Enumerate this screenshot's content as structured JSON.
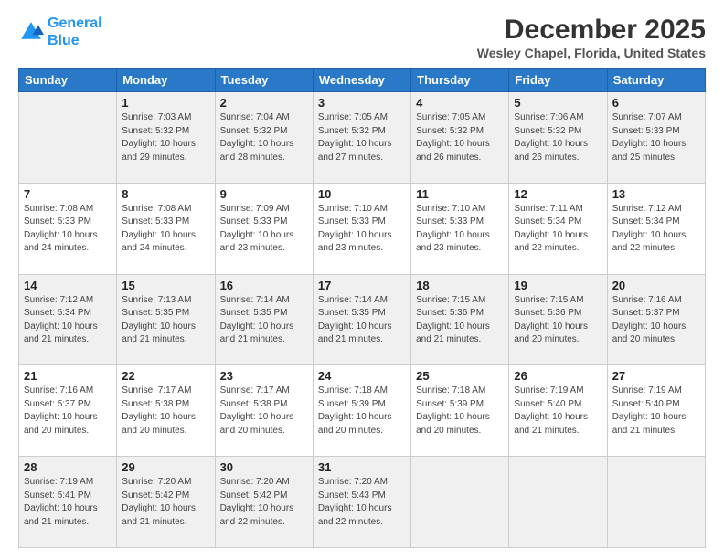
{
  "header": {
    "logo_line1": "General",
    "logo_line2": "Blue",
    "month": "December 2025",
    "location": "Wesley Chapel, Florida, United States"
  },
  "days_of_week": [
    "Sunday",
    "Monday",
    "Tuesday",
    "Wednesday",
    "Thursday",
    "Friday",
    "Saturday"
  ],
  "weeks": [
    [
      {
        "num": "",
        "info": ""
      },
      {
        "num": "1",
        "info": "Sunrise: 7:03 AM\nSunset: 5:32 PM\nDaylight: 10 hours\nand 29 minutes."
      },
      {
        "num": "2",
        "info": "Sunrise: 7:04 AM\nSunset: 5:32 PM\nDaylight: 10 hours\nand 28 minutes."
      },
      {
        "num": "3",
        "info": "Sunrise: 7:05 AM\nSunset: 5:32 PM\nDaylight: 10 hours\nand 27 minutes."
      },
      {
        "num": "4",
        "info": "Sunrise: 7:05 AM\nSunset: 5:32 PM\nDaylight: 10 hours\nand 26 minutes."
      },
      {
        "num": "5",
        "info": "Sunrise: 7:06 AM\nSunset: 5:32 PM\nDaylight: 10 hours\nand 26 minutes."
      },
      {
        "num": "6",
        "info": "Sunrise: 7:07 AM\nSunset: 5:33 PM\nDaylight: 10 hours\nand 25 minutes."
      }
    ],
    [
      {
        "num": "7",
        "info": "Sunrise: 7:08 AM\nSunset: 5:33 PM\nDaylight: 10 hours\nand 24 minutes."
      },
      {
        "num": "8",
        "info": "Sunrise: 7:08 AM\nSunset: 5:33 PM\nDaylight: 10 hours\nand 24 minutes."
      },
      {
        "num": "9",
        "info": "Sunrise: 7:09 AM\nSunset: 5:33 PM\nDaylight: 10 hours\nand 23 minutes."
      },
      {
        "num": "10",
        "info": "Sunrise: 7:10 AM\nSunset: 5:33 PM\nDaylight: 10 hours\nand 23 minutes."
      },
      {
        "num": "11",
        "info": "Sunrise: 7:10 AM\nSunset: 5:33 PM\nDaylight: 10 hours\nand 23 minutes."
      },
      {
        "num": "12",
        "info": "Sunrise: 7:11 AM\nSunset: 5:34 PM\nDaylight: 10 hours\nand 22 minutes."
      },
      {
        "num": "13",
        "info": "Sunrise: 7:12 AM\nSunset: 5:34 PM\nDaylight: 10 hours\nand 22 minutes."
      }
    ],
    [
      {
        "num": "14",
        "info": "Sunrise: 7:12 AM\nSunset: 5:34 PM\nDaylight: 10 hours\nand 21 minutes."
      },
      {
        "num": "15",
        "info": "Sunrise: 7:13 AM\nSunset: 5:35 PM\nDaylight: 10 hours\nand 21 minutes."
      },
      {
        "num": "16",
        "info": "Sunrise: 7:14 AM\nSunset: 5:35 PM\nDaylight: 10 hours\nand 21 minutes."
      },
      {
        "num": "17",
        "info": "Sunrise: 7:14 AM\nSunset: 5:35 PM\nDaylight: 10 hours\nand 21 minutes."
      },
      {
        "num": "18",
        "info": "Sunrise: 7:15 AM\nSunset: 5:36 PM\nDaylight: 10 hours\nand 21 minutes."
      },
      {
        "num": "19",
        "info": "Sunrise: 7:15 AM\nSunset: 5:36 PM\nDaylight: 10 hours\nand 20 minutes."
      },
      {
        "num": "20",
        "info": "Sunrise: 7:16 AM\nSunset: 5:37 PM\nDaylight: 10 hours\nand 20 minutes."
      }
    ],
    [
      {
        "num": "21",
        "info": "Sunrise: 7:16 AM\nSunset: 5:37 PM\nDaylight: 10 hours\nand 20 minutes."
      },
      {
        "num": "22",
        "info": "Sunrise: 7:17 AM\nSunset: 5:38 PM\nDaylight: 10 hours\nand 20 minutes."
      },
      {
        "num": "23",
        "info": "Sunrise: 7:17 AM\nSunset: 5:38 PM\nDaylight: 10 hours\nand 20 minutes."
      },
      {
        "num": "24",
        "info": "Sunrise: 7:18 AM\nSunset: 5:39 PM\nDaylight: 10 hours\nand 20 minutes."
      },
      {
        "num": "25",
        "info": "Sunrise: 7:18 AM\nSunset: 5:39 PM\nDaylight: 10 hours\nand 20 minutes."
      },
      {
        "num": "26",
        "info": "Sunrise: 7:19 AM\nSunset: 5:40 PM\nDaylight: 10 hours\nand 21 minutes."
      },
      {
        "num": "27",
        "info": "Sunrise: 7:19 AM\nSunset: 5:40 PM\nDaylight: 10 hours\nand 21 minutes."
      }
    ],
    [
      {
        "num": "28",
        "info": "Sunrise: 7:19 AM\nSunset: 5:41 PM\nDaylight: 10 hours\nand 21 minutes."
      },
      {
        "num": "29",
        "info": "Sunrise: 7:20 AM\nSunset: 5:42 PM\nDaylight: 10 hours\nand 21 minutes."
      },
      {
        "num": "30",
        "info": "Sunrise: 7:20 AM\nSunset: 5:42 PM\nDaylight: 10 hours\nand 22 minutes."
      },
      {
        "num": "31",
        "info": "Sunrise: 7:20 AM\nSunset: 5:43 PM\nDaylight: 10 hours\nand 22 minutes."
      },
      {
        "num": "",
        "info": ""
      },
      {
        "num": "",
        "info": ""
      },
      {
        "num": "",
        "info": ""
      }
    ]
  ]
}
